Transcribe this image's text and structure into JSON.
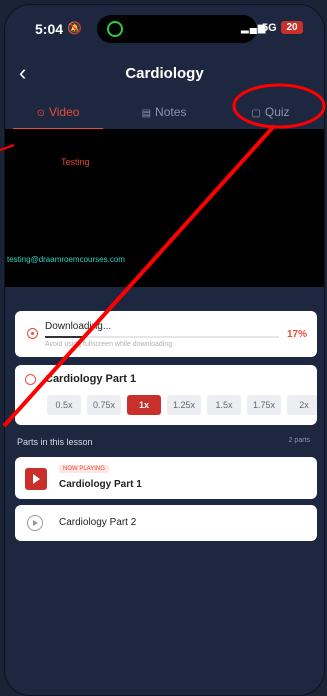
{
  "status": {
    "time": "5:04",
    "network": "5G",
    "battery": "20"
  },
  "header": {
    "title": "Cardiology",
    "back_label": "‹"
  },
  "tabs": [
    {
      "label": "Video",
      "icon": "play-circle-icon"
    },
    {
      "label": "Notes",
      "icon": "notes-icon"
    },
    {
      "label": "Quiz",
      "icon": "quiz-icon"
    }
  ],
  "video": {
    "watermark_top": "Testing",
    "watermark_bottom": "testing@draamroemcourses.com"
  },
  "download": {
    "label": "Downloading...",
    "hint": "Avoid using fullscreen while downloading",
    "percent": "17%",
    "progress": 0.17
  },
  "player": {
    "lesson_name": "Cardiology Part 1",
    "speeds": [
      "0.5x",
      "0.75x",
      "1x",
      "1.25x",
      "1.5x",
      "1.75x",
      "2x"
    ],
    "selected_speed": "1x"
  },
  "parts": {
    "heading": "Parts in this lesson",
    "count": "2 parts",
    "items": [
      {
        "badge": "NOW PLAYING",
        "name": "Cardiology Part 1"
      },
      {
        "name": "Cardiology Part 2"
      }
    ]
  },
  "colors": {
    "accent": "#e74c3c",
    "background": "#1e2740",
    "annotation": "#ff0000"
  }
}
